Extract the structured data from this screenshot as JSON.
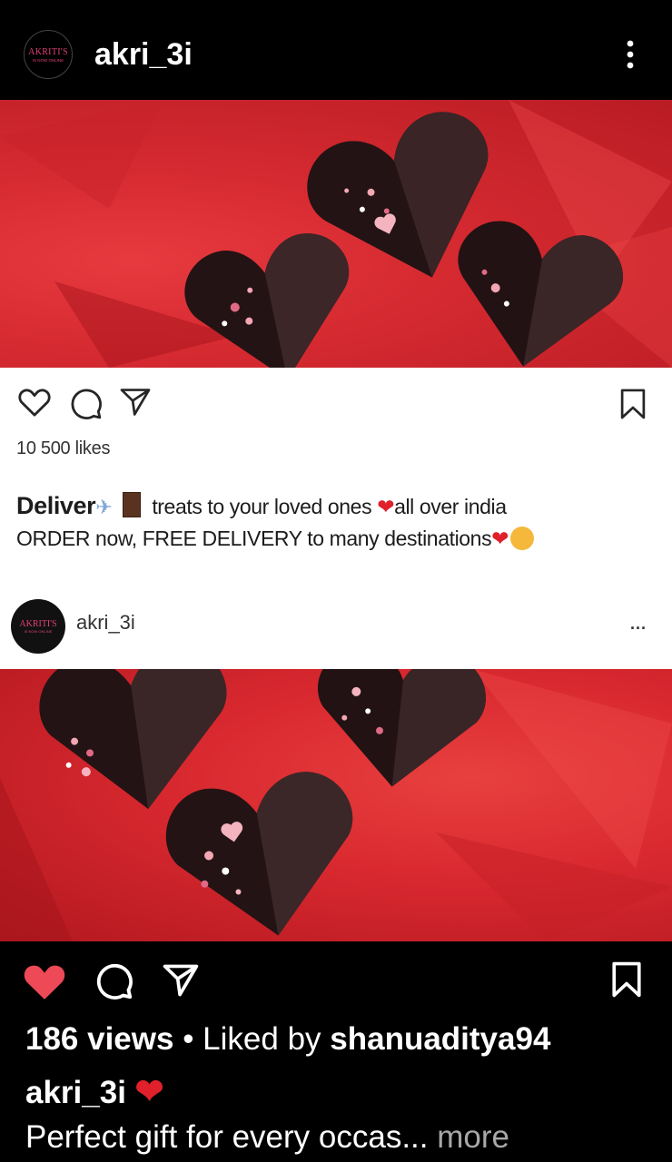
{
  "header": {
    "avatar_brand": "AKRITI'S",
    "avatar_tagline": "IS NOW ONLINE",
    "username": "akri_3i"
  },
  "inner_post": {
    "likes": "10 500 likes",
    "caption_bold": "Deliver",
    "caption_line1": "treats to your loved ones",
    "caption_line1b": "all over india",
    "caption_line2": "ORDER now, FREE DELIVERY to many destinations",
    "avatar_brand": "AKRITI'S",
    "avatar_tagline": "IS NOW ONLINE",
    "username": "akri_3i",
    "more_label": "..."
  },
  "post": {
    "views": "186 views",
    "separator": " • ",
    "liked_by_prefix": "Liked by ",
    "liked_by_user": "shanuaditya94",
    "caption_user": "akri_3i",
    "caption_text": "Perfect gift for every occas",
    "ellipsis": "...",
    "more_label": "more"
  },
  "colors": {
    "like_active": "#ed4956",
    "background": "#000000",
    "heart_emoji": "#e0202a"
  }
}
